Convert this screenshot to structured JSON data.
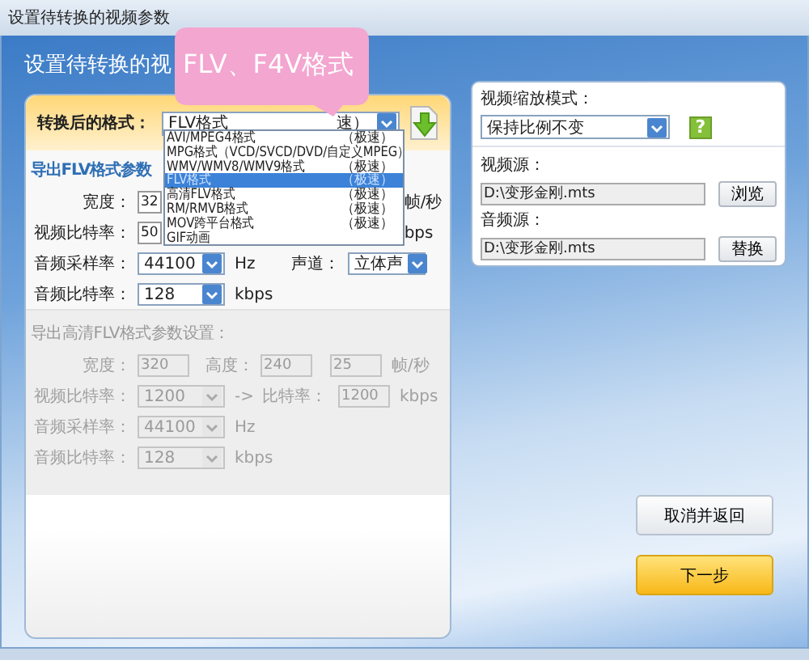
{
  "window": {
    "title": "设置待转换的视频参数"
  },
  "header": "设置待转换的视",
  "callout": "FLV、F4V格式",
  "format": {
    "label": "转换后的格式：",
    "value": "FLV格式",
    "suffix": "速）"
  },
  "format_options": [
    {
      "name": "AVI/MPEG4格式",
      "speed": "（极速）",
      "selected": false
    },
    {
      "name": "MPG格式（VCD/SVCD/DVD/自定义MPEG）",
      "selected": false
    },
    {
      "name": "WMV/WMV8/WMV9格式",
      "speed": "（极速）",
      "selected": false
    },
    {
      "name": "FLV格式",
      "speed": "（极速）",
      "selected": true
    },
    {
      "name": "高清FLV格式",
      "speed": "（极速）",
      "selected": false
    },
    {
      "name": "RM/RMVB格式",
      "speed": "（极速）",
      "selected": false
    },
    {
      "name": "MOV跨平台格式",
      "speed": "（极速）",
      "selected": false
    },
    {
      "name": "GIF动画",
      "selected": false
    }
  ],
  "flv": {
    "title": "导出FLV格式参数",
    "width_label": "宽度：",
    "width_value": "32",
    "fps_unit": "帧/秒",
    "vbitrate_label": "视频比特率：",
    "vbitrate_value": "50",
    "vbitrate_unit": "bps",
    "asr_label": "音频采样率：",
    "asr_value": "44100",
    "asr_unit": "Hz",
    "channel_label": "声道：",
    "channel_value": "立体声",
    "abr_label": "音频比特率：",
    "abr_value": "128",
    "abr_unit": "kbps"
  },
  "hd": {
    "title": "导出高清FLV格式参数设置：",
    "disabled": true,
    "width_label": "宽度：",
    "width_value": "320",
    "height_label": "高度：",
    "height_value": "240",
    "fps_value": "25",
    "fps_unit": "帧/秒",
    "vbitrate_label": "视频比特率：",
    "vbitrate_value": "1200",
    "arrow": "->",
    "bitrate_label": "比特率：",
    "bitrate_value": "1200",
    "bitrate_unit": "kbps",
    "asr_label": "音频采样率：",
    "asr_value": "44100",
    "asr_unit": "Hz",
    "abr_label": "音频比特率：",
    "abr_value": "128",
    "abr_unit": "kbps"
  },
  "source": {
    "scale_label": "视频缩放模式：",
    "scale_value": "保持比例不变",
    "help": "?",
    "video_label": "视频源：",
    "video_path": "D:\\变形金刚.mts",
    "browse": "浏览",
    "audio_label": "音频源：",
    "audio_path": "D:\\变形金刚.mts",
    "replace": "替换"
  },
  "buttons": {
    "cancel": "取消并返回",
    "next": "下一步"
  }
}
